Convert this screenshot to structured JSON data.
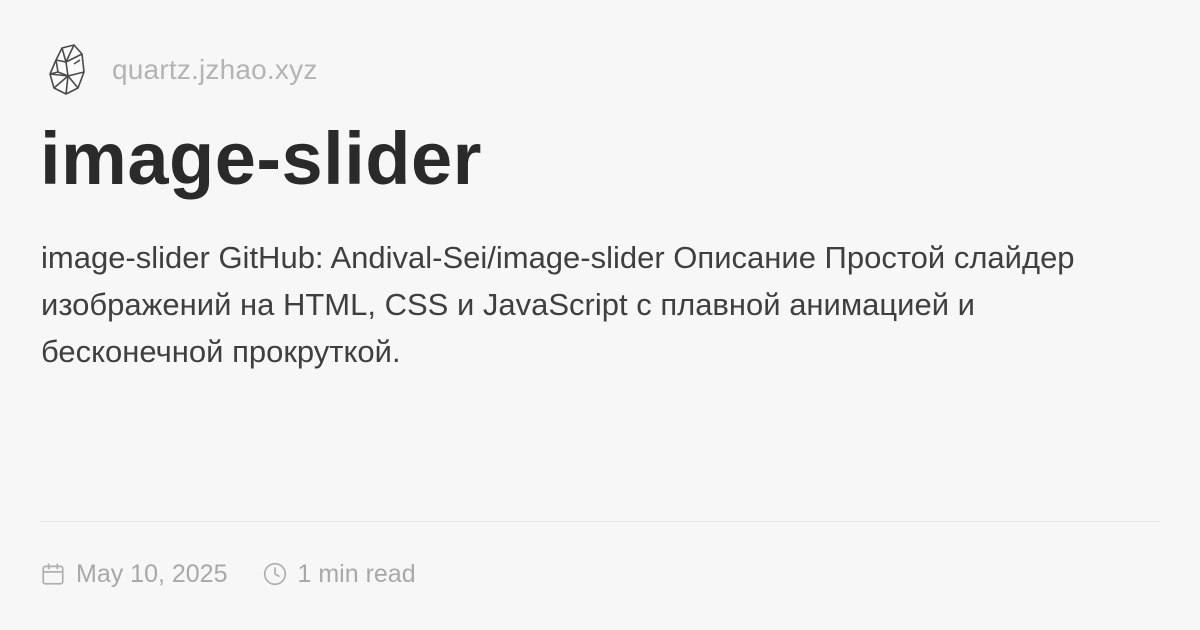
{
  "site": {
    "logo_icon": "crystal-logo-icon",
    "url": "quartz.jzhao.xyz"
  },
  "page": {
    "title": "image-slider",
    "description": "image-slider GitHub: Andival-Sei/image-slider Описание Простой слайдер изображений на HTML, CSS и JavaScript с плавной анимацией и бесконечной прокруткой."
  },
  "meta": {
    "date_icon": "calendar-icon",
    "date": "May 10, 2025",
    "reading_time_icon": "clock-icon",
    "reading_time": "1 min read"
  },
  "colors": {
    "background": "#f7f7f8",
    "title": "#2a2a2a",
    "body_text": "#3f3f3f",
    "muted": "#b4b4b4",
    "divider": "#e3e3e3"
  }
}
